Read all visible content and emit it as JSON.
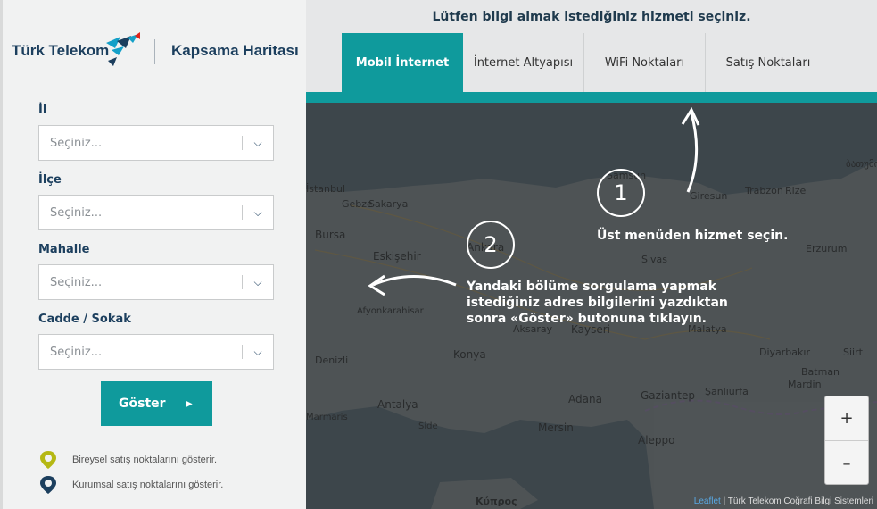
{
  "header": {
    "prompt": "Lütfen bilgi almak istediğiniz hizmeti seçiniz.",
    "tabs": [
      {
        "label": "Mobil İnternet",
        "active": true
      },
      {
        "label": "İnternet Altyapısı",
        "active": false
      },
      {
        "label": "WiFi Noktaları",
        "active": false
      },
      {
        "label": "Satış Noktaları",
        "active": false
      }
    ]
  },
  "sidebar": {
    "brand": "Türk Telekom",
    "product": "Kapsama Haritası",
    "fields": [
      {
        "label": "İl",
        "placeholder": "Seçiniz..."
      },
      {
        "label": "İlçe",
        "placeholder": "Seçiniz..."
      },
      {
        "label": "Mahalle",
        "placeholder": "Seçiniz..."
      },
      {
        "label": "Cadde / Sokak",
        "placeholder": "Seçiniz..."
      }
    ],
    "show_button": "Göster",
    "legend": [
      {
        "text": "Bireysel satış noktalarını gösterir.",
        "color": "#b5b814"
      },
      {
        "text": "Kurumsal satış noktalarını gösterir.",
        "color": "#1c3f5e"
      }
    ]
  },
  "overlay": {
    "step1_number": "1",
    "step1_text": "Üst menüden hizmet seçin.",
    "step2_number": "2",
    "step2_line1": "Yandaki bölüme sorgulama yapmak",
    "step2_line2": "istediğiniz adres bilgilerini yazdıktan",
    "step2_line3": "sonra «Göster» butonuna tıklayın."
  },
  "map": {
    "cities": [
      "İstanbul",
      "Gebze",
      "Sakarya",
      "Bursa",
      "Eskişehir",
      "Ankara",
      "Samsun",
      "Giresun",
      "Trabzon",
      "Rize",
      "Sivas",
      "Erzurum",
      "Afyonkarahisar",
      "Aksaray",
      "Kayseri",
      "Malatya",
      "Denizli",
      "Konya",
      "Diyarbakır",
      "Siirt",
      "Batman",
      "Mardin",
      "Antalya",
      "Adana",
      "Gaziantep",
      "Şanlıurfa",
      "Marmaris",
      "Side",
      "Mersin",
      "Aleppo",
      "Κύπρος",
      "ბათუმი"
    ],
    "zoom_in": "+",
    "zoom_out": "–",
    "attribution_link": "Leaflet",
    "attribution_text": " | Türk Telekom Coğrafi Bilgi Sistemleri"
  },
  "colors": {
    "accent": "#0f9a9c",
    "brand": "#1c3f5e"
  }
}
